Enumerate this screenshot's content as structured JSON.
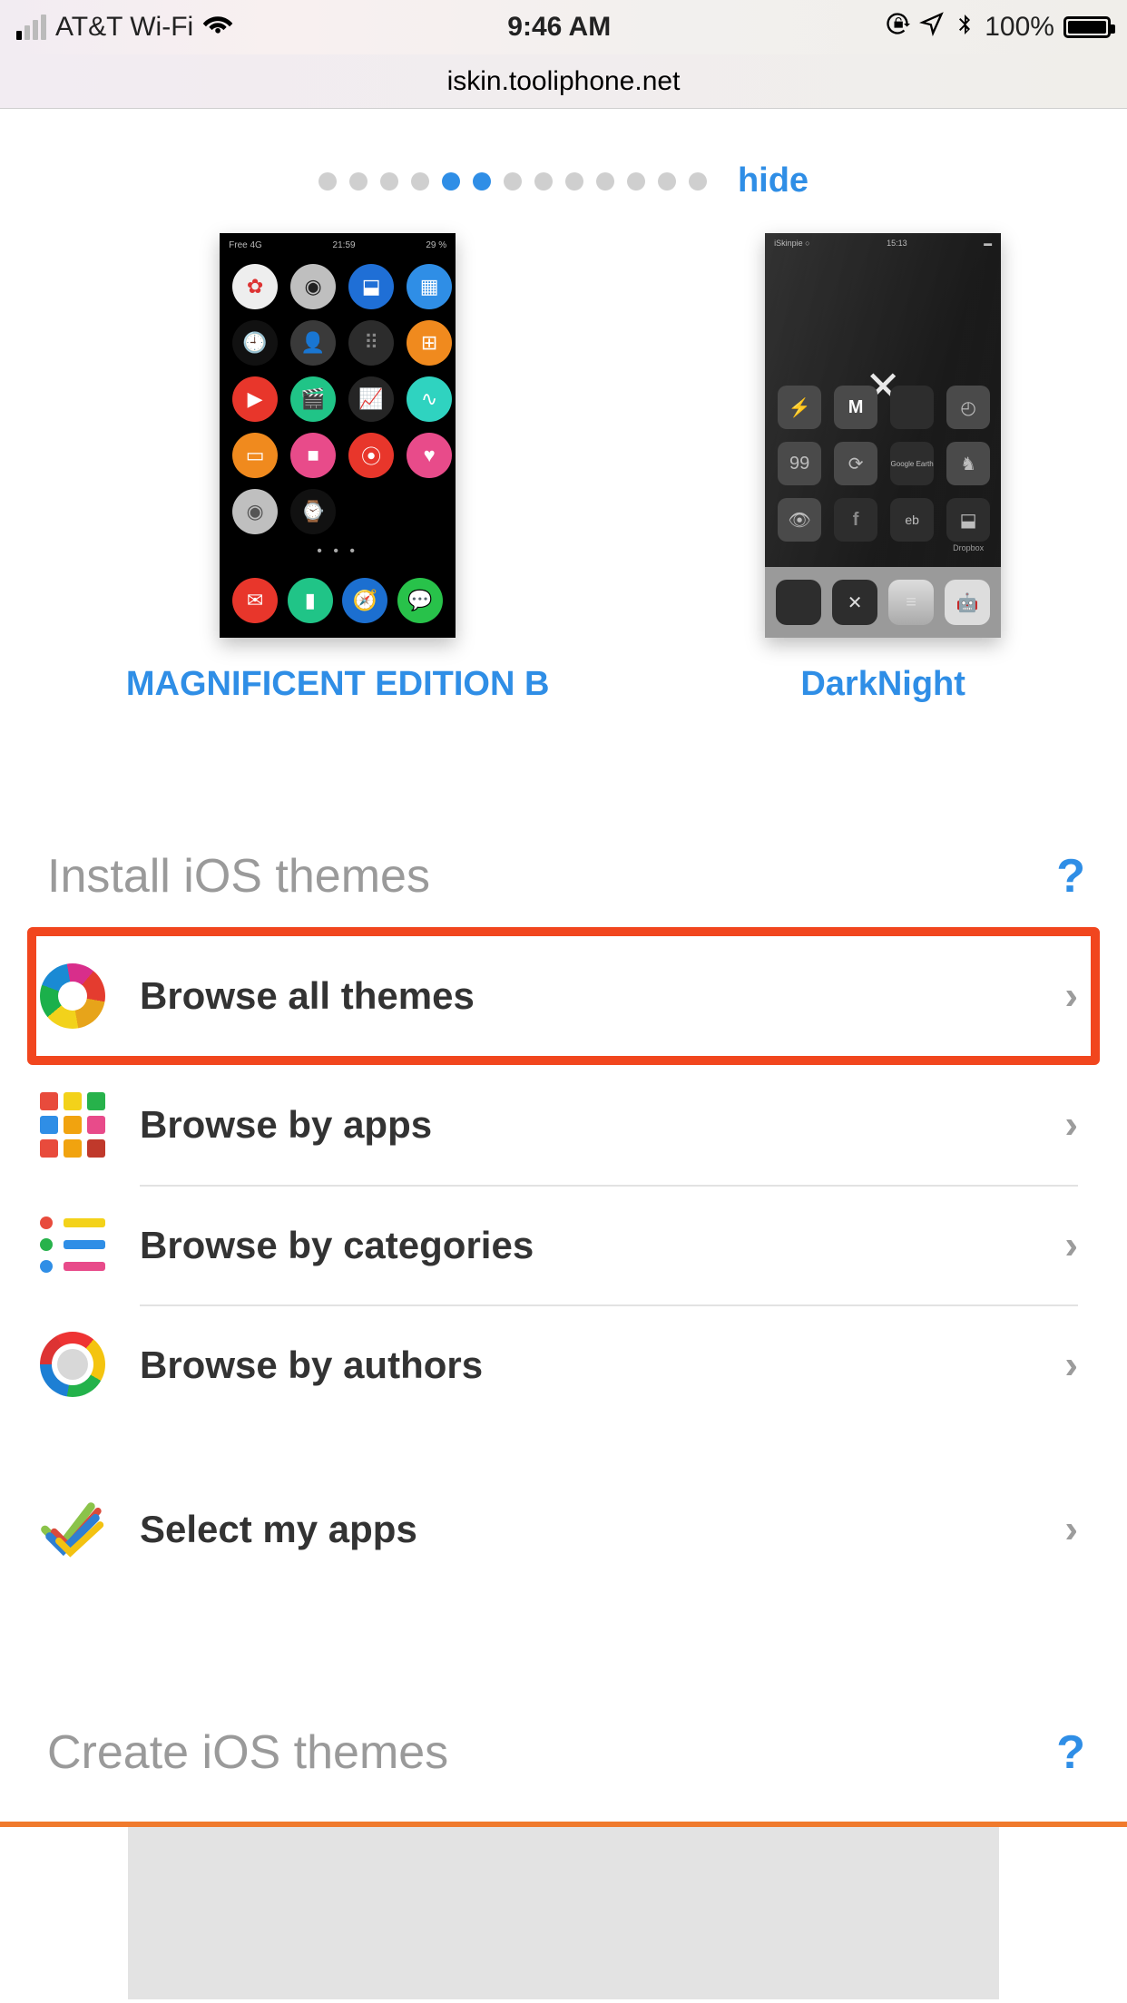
{
  "status": {
    "carrier": "AT&T Wi-Fi",
    "time": "9:46 AM",
    "battery_pct": "100%",
    "icons": {
      "signal": "cell-signal-icon",
      "wifi": "wifi-icon",
      "lock": "orientation-lock-icon",
      "location": "location-icon",
      "bluetooth": "bluetooth-icon",
      "battery": "battery-icon"
    }
  },
  "url": "iskin.tooliphone.net",
  "carousel": {
    "total_dots": 13,
    "active_indices": [
      5,
      6
    ],
    "hide_label": "hide"
  },
  "themes": [
    {
      "title": "MAGNIFICENT EDITION B"
    },
    {
      "title": "DarkNight"
    }
  ],
  "preview1": {
    "status_left": "Free  4G",
    "status_center": "21:59",
    "status_right": "29 %"
  },
  "preview2": {
    "status_left": "iSkinpie ○",
    "status_center": "15:13",
    "labels": {
      "google_earth": "Google Earth",
      "dropbox": "Dropbox"
    },
    "m_letter": "M",
    "ebay_text": "eb",
    "ninetynine": "99"
  },
  "sections": {
    "install": "Install iOS themes",
    "create": "Create iOS themes",
    "help": "?"
  },
  "menu": [
    {
      "id": "browse-all",
      "label": "Browse all themes",
      "icon": "swirl-icon",
      "highlighted": true
    },
    {
      "id": "browse-apps",
      "label": "Browse by apps",
      "icon": "grid9-icon",
      "highlighted": false
    },
    {
      "id": "browse-categories",
      "label": "Browse by categories",
      "icon": "list-icon",
      "highlighted": false
    },
    {
      "id": "browse-authors",
      "label": "Browse by authors",
      "icon": "authors-icon",
      "highlighted": false
    },
    {
      "id": "select-apps",
      "label": "Select my apps",
      "icon": "checks-icon",
      "highlighted": false
    }
  ]
}
